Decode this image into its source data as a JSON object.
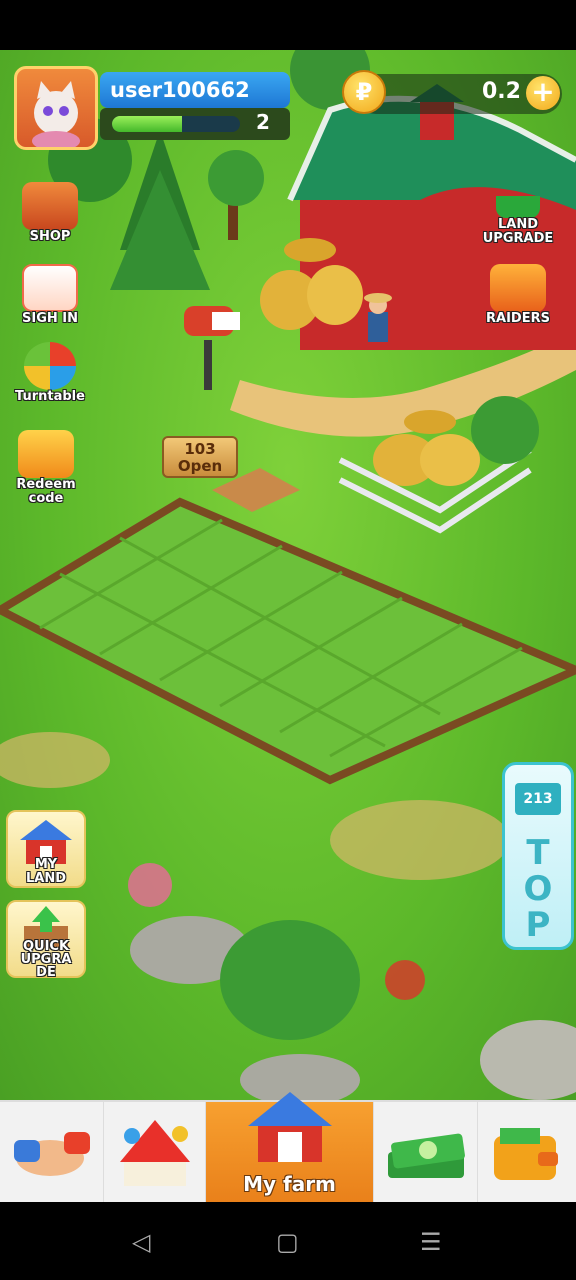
{
  "player": {
    "username": "user100662",
    "level": "2",
    "level_progress": 0.55
  },
  "currency": {
    "coin_symbol": "₽",
    "amount": "0.2",
    "add_label": "+"
  },
  "side_menu": {
    "shop": "SHOP",
    "sign_in": "SIGH IN",
    "turntable": "Turntable",
    "redeem_line1": "Redeem",
    "redeem_line2": "code",
    "land_upgrade_line1": "LAND",
    "land_upgrade_line2": "UPGRADE",
    "raiders": "RAIDERS",
    "my_land_line1": "MY",
    "my_land_line2": "LAND",
    "quick_upgrade_line1": "QUICK",
    "quick_upgrade_line2": "UPGRA",
    "quick_upgrade_line3": "DE",
    "top": "TOP",
    "top_podium": "213"
  },
  "plot_sign": {
    "number": "103",
    "status": "Open"
  },
  "bottom_nav": {
    "items": [
      {
        "key": "handshake",
        "label": ""
      },
      {
        "key": "circus",
        "label": ""
      },
      {
        "key": "my-farm",
        "label": "My farm"
      },
      {
        "key": "cash",
        "label": ""
      },
      {
        "key": "wallet",
        "label": ""
      }
    ]
  },
  "system_nav": {
    "back": "◁",
    "home": "▢",
    "menu": "☰"
  },
  "colors": {
    "grass": "#5cb82a",
    "accent_orange": "#f2901e",
    "barn_roof": "#1f8f5a",
    "barn_wall": "#c72a2a"
  }
}
